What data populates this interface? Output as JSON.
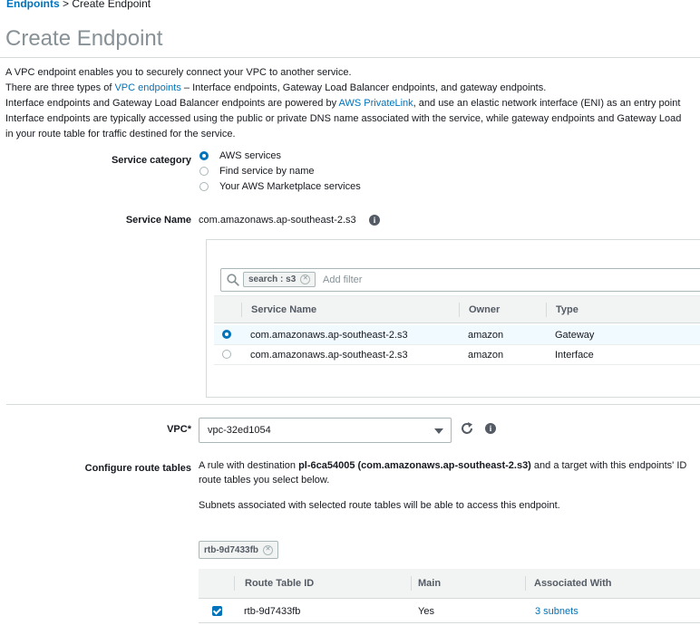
{
  "breadcrumb": {
    "link": "Endpoints",
    "separator": ">",
    "current": "Create Endpoint"
  },
  "page_title": "Create Endpoint",
  "intro": {
    "line1": "A VPC endpoint enables you to securely connect your VPC to another service.",
    "line2_pre": "There are three types of",
    "line2_link": "VPC endpoints",
    "line2_post": "– Interface endpoints, Gateway Load Balancer endpoints, and gateway endpoints.",
    "line3_pre": "Interface endpoints and Gateway Load Balancer endpoints are powered by",
    "line3_link": "AWS PrivateLink",
    "line3_post": ", and use an elastic network interface (ENI) as an entry point",
    "line4": "Interface endpoints are typically accessed using the public or private DNS name associated with the service, while gateway endpoints and Gateway Load",
    "line5": "in your route table for traffic destined for the service."
  },
  "service_category": {
    "label": "Service category",
    "options": [
      {
        "label": "AWS services",
        "selected": true
      },
      {
        "label": "Find service by name",
        "selected": false
      },
      {
        "label": "Your AWS Marketplace services",
        "selected": false
      }
    ]
  },
  "service_name": {
    "label": "Service Name",
    "value": "com.amazonaws.ap-southeast-2.s3",
    "info_icon": "info-icon"
  },
  "service_search": {
    "chip": "search : s3",
    "placeholder": "Add filter",
    "icon": "search-icon"
  },
  "services_table": {
    "columns": [
      "Service Name",
      "Owner",
      "Type"
    ],
    "rows": [
      {
        "service_name": "com.amazonaws.ap-southeast-2.s3",
        "owner": "amazon",
        "type": "Gateway",
        "selected": true
      },
      {
        "service_name": "com.amazonaws.ap-southeast-2.s3",
        "owner": "amazon",
        "type": "Interface",
        "selected": false
      }
    ]
  },
  "vpc": {
    "label": "VPC*",
    "value": "vpc-32ed1054",
    "refresh_icon": "refresh-icon",
    "info_icon": "info-icon"
  },
  "route_tables": {
    "label": "Configure route tables",
    "desc1_pre": "A rule with destination",
    "desc1_bold": "pl-6ca54005 (com.amazonaws.ap-southeast-2.s3)",
    "desc1_post": "and a target with this endpoints' ID",
    "desc2": "route tables you select below.",
    "desc3": "Subnets associated with selected route tables will be able to access this endpoint.",
    "chip": "rtb-9d7433fb",
    "columns": [
      "Route Table ID",
      "Main",
      "Associated With"
    ],
    "rows": [
      {
        "route_table_id": "rtb-9d7433fb",
        "main": "Yes",
        "associated_with": "3 subnets",
        "checked": true
      }
    ]
  },
  "colors": {
    "accent": "#0073bb",
    "title_gray": "#879196",
    "border": "#d5dbdb",
    "header_bg": "#f2f3f3",
    "selected_row": "#f1faff"
  }
}
